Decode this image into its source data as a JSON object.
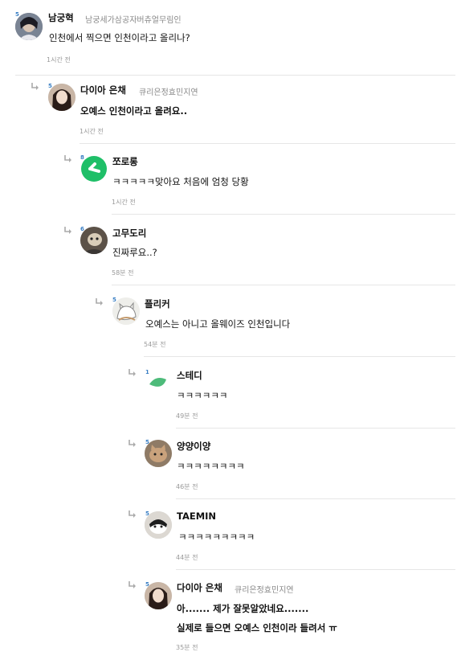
{
  "comments": [
    {
      "level": "5",
      "nick": "남궁혁",
      "title": "남궁세가삼공자버츄얼무림인",
      "lines": [
        "인천에서 찍으면 인천이라고 올리나?"
      ],
      "time": "1시간 전",
      "avatar": "avatar-dark-hair-man"
    },
    {
      "level": "5",
      "nick": "다이아 은채",
      "title": "큐리은정효민지연",
      "lines": [
        "오예스 인천이라고 올려요.."
      ],
      "time": "1시간 전",
      "avatar": "avatar-long-hair-woman"
    },
    {
      "level": "8",
      "nick": "쪼로롱",
      "title": "",
      "lines": [
        "ㅋㅋㅋㅋㅋ맞아요 처음에 엄청 당황"
      ],
      "time": "1시간 전",
      "avatar": "avatar-green-logo"
    },
    {
      "level": "6",
      "nick": "고무도리",
      "title": "",
      "lines": [
        "진짜루요..?"
      ],
      "time": "58분 전",
      "avatar": "avatar-cartoon-face"
    },
    {
      "level": "5",
      "nick": "플리커",
      "title": "",
      "lines": [
        "오예스는 아니고 올웨이즈 인천입니다"
      ],
      "time": "54분 전",
      "avatar": "avatar-white-cat-sketch"
    },
    {
      "level": "1",
      "nick": "스테디",
      "title": "",
      "lines": [
        "ㅋㅋㅋㅋㅋㅋ"
      ],
      "time": "49분 전",
      "avatar": "avatar-green-leaf"
    },
    {
      "level": "5",
      "nick": "양양이양",
      "title": "",
      "lines": [
        "ㅋㅋㅋㅋㅋㅋㅋㅋ"
      ],
      "time": "46분 전",
      "avatar": "avatar-cat-photo"
    },
    {
      "level": "5",
      "nick": "TAEMIN",
      "title": "",
      "lines": [
        "ㅋㅋㅋㅋㅋㅋㅋㅋㅋ"
      ],
      "time": "44분 전",
      "avatar": "avatar-tuxedo-cat"
    },
    {
      "level": "5",
      "nick": "다이아 은채",
      "title": "큐리은정효민지연",
      "lines": [
        "아....... 제가 잘못알았네요.......",
        "실제로 들으면 오예스 인천이라 들려서 ㅠ"
      ],
      "time": "35분 전",
      "avatar": "avatar-long-hair-woman"
    }
  ],
  "colors": {
    "accent": "#3a7fc4",
    "time": "#999999",
    "title": "#888888",
    "divider": "#e6e6e6",
    "reply_arrow": "#aaaaaa"
  },
  "icons": {
    "reply": "reply-arrow-icon",
    "level": "level-badge-icon"
  }
}
